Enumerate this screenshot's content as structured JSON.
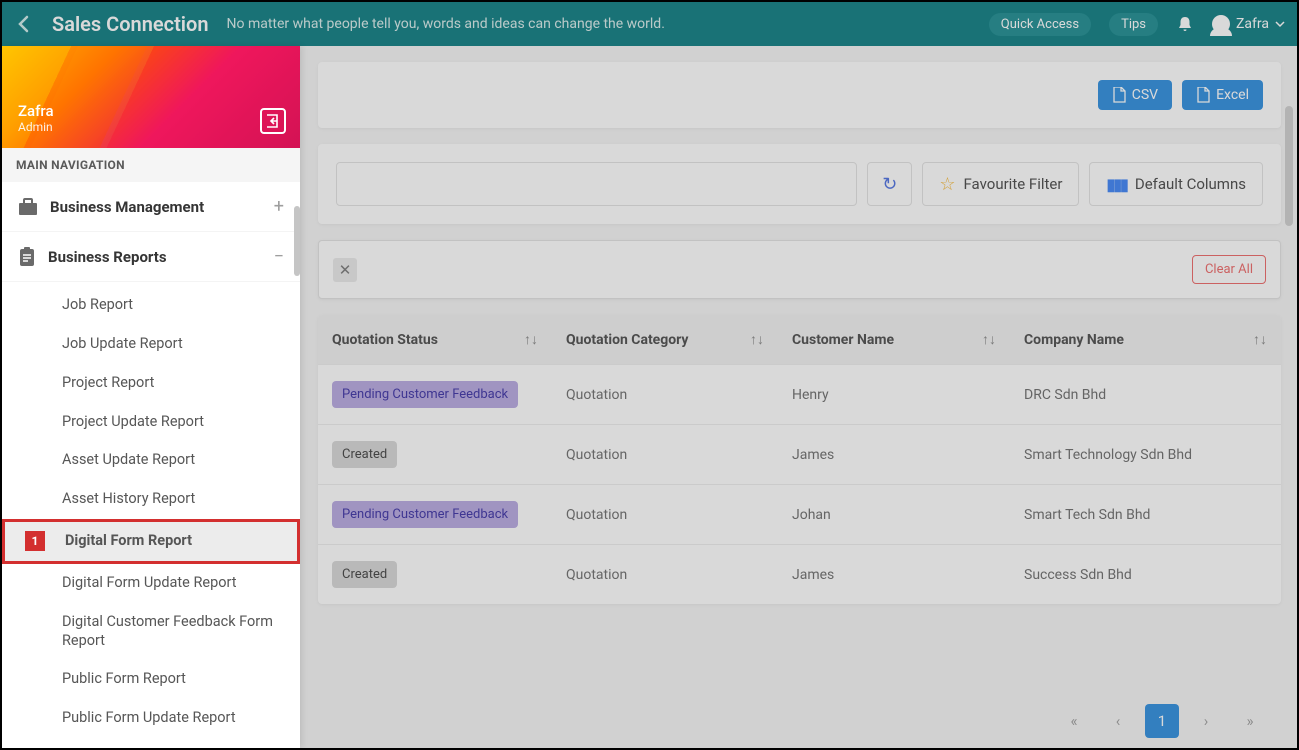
{
  "header": {
    "brand": "Sales Connection",
    "tagline": "No matter what people tell you, words and ideas can change the world.",
    "quick_access": "Quick Access",
    "tips": "Tips",
    "user_name": "Zafra"
  },
  "sidebar": {
    "user_name": "Zafra",
    "user_role": "Admin",
    "nav_title": "MAIN NAVIGATION",
    "sections": [
      {
        "label": "Business Management",
        "toggle": "+"
      },
      {
        "label": "Business Reports",
        "toggle": "−"
      }
    ],
    "report_items": [
      "Job Report",
      "Job Update Report",
      "Project Report",
      "Project Update Report",
      "Asset Update Report",
      "Asset History Report",
      "Digital Form Report",
      "Digital Form Update Report",
      "Digital Customer Feedback Form Report",
      "Public Form Report",
      "Public Form Update Report"
    ],
    "callout": "1"
  },
  "toolbar": {
    "csv": "CSV",
    "excel": "Excel",
    "fav_filter": "Favourite Filter",
    "def_cols": "Default Columns",
    "clear_all": "Clear All"
  },
  "table": {
    "columns": [
      "Quotation Status",
      "Quotation Category",
      "Customer Name",
      "Company Name"
    ],
    "rows": [
      {
        "status": "Pending Customer Feedback",
        "status_kind": "pcf",
        "category": "Quotation",
        "customer": "Henry",
        "company": "DRC Sdn Bhd"
      },
      {
        "status": "Created",
        "status_kind": "created",
        "category": "Quotation",
        "customer": "James",
        "company": "Smart Technology Sdn Bhd"
      },
      {
        "status": "Pending Customer Feedback",
        "status_kind": "pcf",
        "category": "Quotation",
        "customer": "Johan",
        "company": "Smart Tech Sdn Bhd"
      },
      {
        "status": "Created",
        "status_kind": "created",
        "category": "Quotation",
        "customer": "James",
        "company": "Success Sdn Bhd"
      }
    ]
  },
  "pagination": {
    "page": "1"
  }
}
